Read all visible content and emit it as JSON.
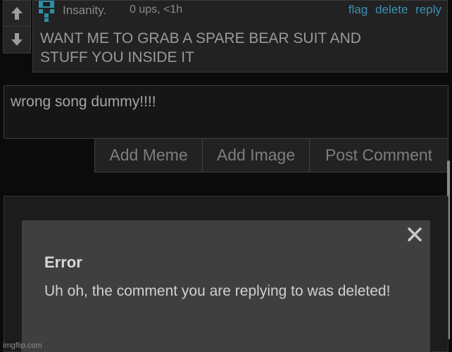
{
  "comment": {
    "username": "Insanity.",
    "meta": "0 ups, <1h",
    "actions": [
      "flag",
      "delete",
      "reply"
    ],
    "text_line1": "WANT ME TO GRAB A SPARE BEAR SUIT AND",
    "text_line2": "STUFF YOU INSIDE IT",
    "vote_up_icon": "arrow-up-icon",
    "vote_down_icon": "arrow-down-icon",
    "accent_color": "#3e8fb5"
  },
  "reply": {
    "value": "wrong song dummy!!!!"
  },
  "reply_buttons": {
    "add_meme": "Add Meme",
    "add_image": "Add Image",
    "post_comment": "Post Comment"
  },
  "error_modal": {
    "title": "Error",
    "message": "Uh oh, the comment you are replying to was deleted!",
    "close_icon": "close-icon"
  },
  "watermark": "imgflip.com"
}
